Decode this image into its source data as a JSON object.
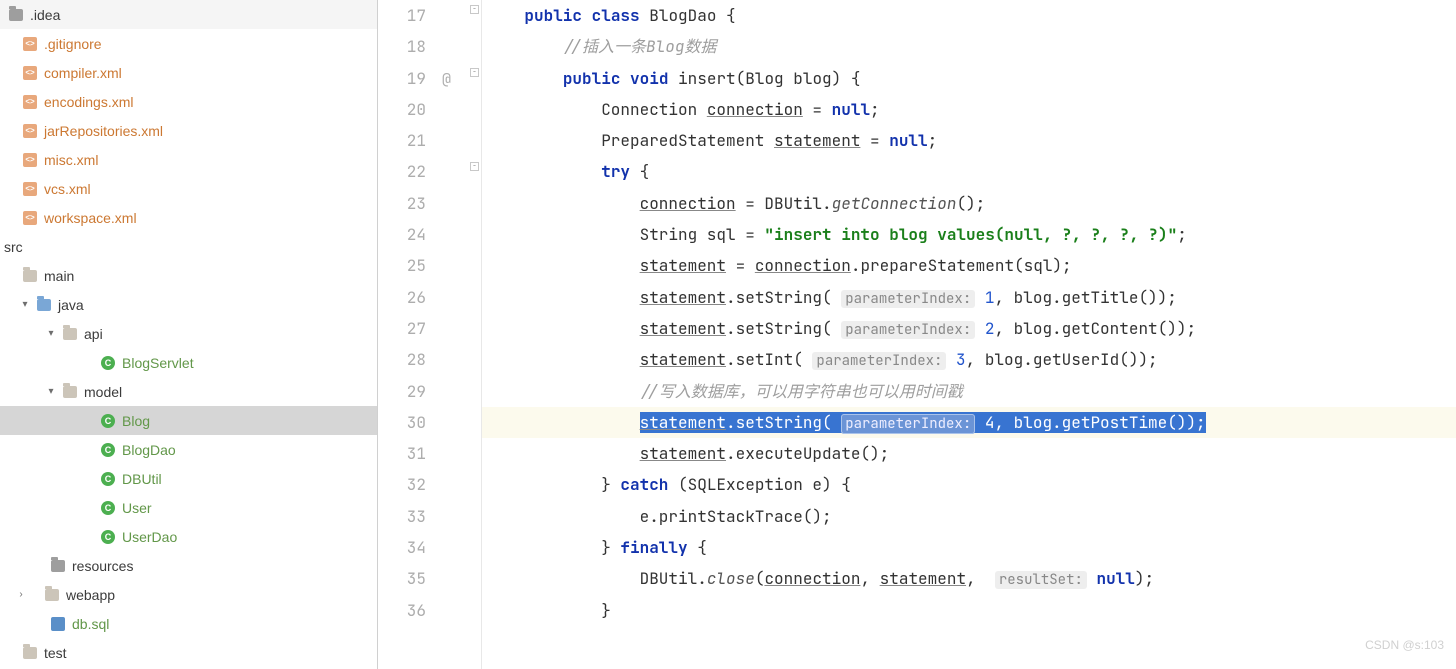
{
  "tree": {
    "idea_folder": ".idea",
    "gitignore": ".gitignore",
    "compiler": "compiler.xml",
    "encodings": "encodings.xml",
    "jarRepositories": "jarRepositories.xml",
    "misc": "misc.xml",
    "vcs": "vcs.xml",
    "workspace": "workspace.xml",
    "src": "src",
    "main": "main",
    "java": "java",
    "api": "api",
    "blogservlet": "BlogServlet",
    "model": "model",
    "blog": "Blog",
    "blogdao": "BlogDao",
    "dbutil": "DBUtil",
    "user": "User",
    "userdao": "UserDao",
    "resources": "resources",
    "webapp": "webapp",
    "dbsql": "db.sql",
    "test": "test"
  },
  "icons": {
    "class_letter": "C",
    "xml_letter": "<>"
  },
  "line_numbers": [
    "17",
    "18",
    "19",
    "20",
    "21",
    "22",
    "23",
    "24",
    "25",
    "26",
    "27",
    "28",
    "29",
    "30",
    "31",
    "32",
    "33",
    "34",
    "35",
    "36"
  ],
  "gutter_at": "@",
  "code": {
    "l17": {
      "kw1": "public",
      "kw2": "class",
      "name": " BlogDao {"
    },
    "l18": {
      "cm": "//插入一条Blog数据"
    },
    "l19": {
      "kw1": "public",
      "kw2": "void",
      "sig": " insert(Blog blog) {"
    },
    "l20": {
      "a": "Connection ",
      "u": "connection",
      "b": " = ",
      "kw": "null",
      "c": ";"
    },
    "l21": {
      "a": "PreparedStatement ",
      "u": "statement",
      "b": " = ",
      "kw": "null",
      "c": ";"
    },
    "l22": {
      "kw": "try",
      "b": " {"
    },
    "l23": {
      "u": "connection",
      "a": " = DBUtil.",
      "m": "getConnection",
      "b": "();"
    },
    "l24": {
      "a": "String sql = ",
      "s": "\"insert into blog values(null, ?, ?, ?, ?)\"",
      "b": ";"
    },
    "l25": {
      "u1": "statement",
      "a": " = ",
      "u2": "connection",
      "b": ".prepareStatement(sql);"
    },
    "l26": {
      "u": "statement",
      "a": ".setString( ",
      "h": "parameterIndex:",
      "sp": " ",
      "n": "1",
      "b": ", blog.getTitle());"
    },
    "l27": {
      "u": "statement",
      "a": ".setString( ",
      "h": "parameterIndex:",
      "sp": " ",
      "n": "2",
      "b": ", blog.getContent());"
    },
    "l28": {
      "u": "statement",
      "a": ".setInt( ",
      "h": "parameterIndex:",
      "sp": " ",
      "n": "3",
      "b": ", blog.getUserId());"
    },
    "l29": {
      "cm": "//写入数据库，可以用字符串也可以用时间戳"
    },
    "l30": {
      "u": "statement",
      "a": ".setString( ",
      "h": "parameterIndex:",
      "sp": " ",
      "n": "4",
      "b": ", blog.getPostTime());"
    },
    "l31": {
      "u": "statement",
      "a": ".executeUpdate();"
    },
    "l32": {
      "a": "} ",
      "kw": "catch",
      "b": " (SQLException e) {"
    },
    "l33": {
      "a": "e.printStackTrace();"
    },
    "l34": {
      "a": "} ",
      "kw": "finally",
      "b": " {"
    },
    "l35": {
      "a": "DBUtil.",
      "m": "close",
      "b": "(",
      "u1": "connection",
      "c": ", ",
      "u2": "statement",
      "d": ",  ",
      "h": "resultSet:",
      "sp": " ",
      "kw": "null",
      "e": ");"
    },
    "l36": {
      "a": "}"
    }
  },
  "watermark": "CSDN @s:103"
}
